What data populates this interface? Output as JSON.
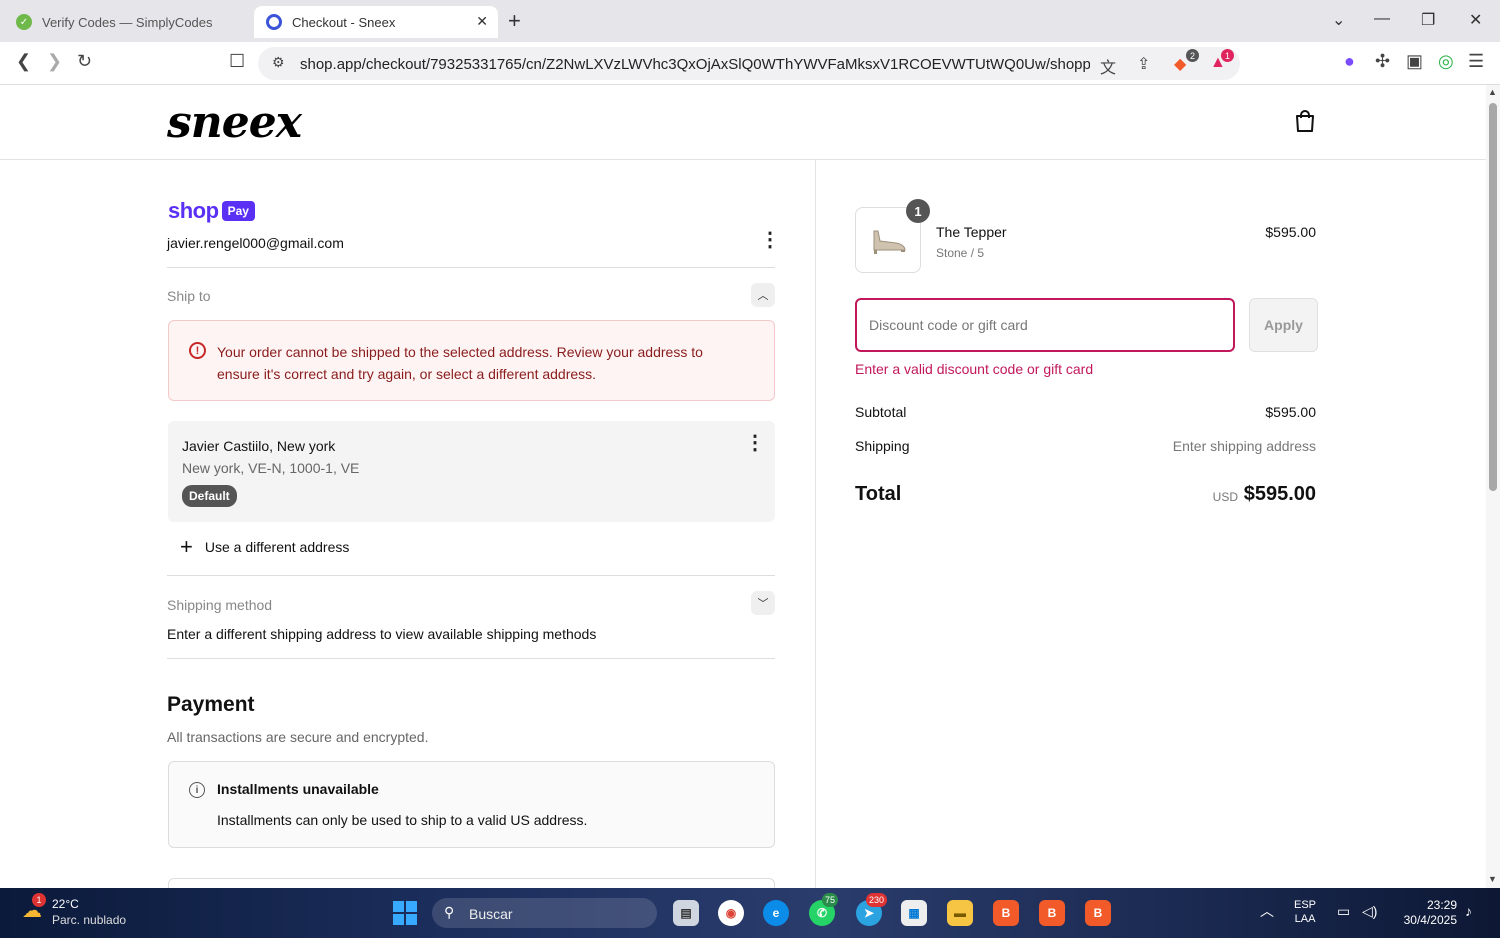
{
  "browser": {
    "tabs": [
      {
        "title": "Verify Codes — SimplyCodes"
      },
      {
        "title": "Checkout - Sneex"
      }
    ],
    "url": "shop.app/checkout/79325331765/cn/Z2NwLXVzLWVhc3QxOjAxSlQ0WThYWVFaMksxV1RCOEVWTUtWQ0Uw/shoppay?r...",
    "extension_badges": {
      "brave_shields": "2",
      "brave_rewards": "1"
    }
  },
  "store": {
    "logo": "sneex"
  },
  "account": {
    "shop_pay_word": "shop",
    "shop_pay_pill": "Pay",
    "email": "javier.rengel000@gmail.com"
  },
  "ship_to": {
    "label": "Ship to",
    "error_message": "Your order cannot be shipped to the selected address. Review your address to ensure it's correct and try again, or select a different address.",
    "address": {
      "name": "Javier Castiilo, New york",
      "line": "New york, VE-N, 1000-1, VE",
      "badge": "Default"
    },
    "add_different": "Use a different address"
  },
  "shipping_method": {
    "label": "Shipping method",
    "message": "Enter a different shipping address to view available shipping methods"
  },
  "payment": {
    "title": "Payment",
    "subtitle": "All transactions are secure and encrypted.",
    "installments_title": "Installments unavailable",
    "installments_text": "Installments can only be used to ship to a valid US address."
  },
  "order": {
    "item": {
      "name": "The Tepper",
      "variant": "Stone / 5",
      "price": "$595.00",
      "quantity": "1"
    },
    "discount": {
      "placeholder": "Discount code or gift card",
      "value": "",
      "apply_label": "Apply",
      "error": "Enter a valid discount code or gift card"
    },
    "subtotal_label": "Subtotal",
    "subtotal_value": "$595.00",
    "shipping_label": "Shipping",
    "shipping_value": "Enter shipping address",
    "total_label": "Total",
    "total_currency": "USD",
    "total_value": "$595.00"
  },
  "taskbar": {
    "weather_badge": "1",
    "weather_temp": "22°C",
    "weather_condition": "Parc. nublado",
    "search_label": "Buscar",
    "whatsapp_badge": "75",
    "telegram_badge": "230",
    "language_top": "ESP",
    "language_bottom": "LAA",
    "time": "23:29",
    "date": "30/4/2025"
  },
  "colors": {
    "accent_error": "#c2185b",
    "shop_pay_purple": "#5a31f4",
    "error_text": "#8a1c1c"
  }
}
